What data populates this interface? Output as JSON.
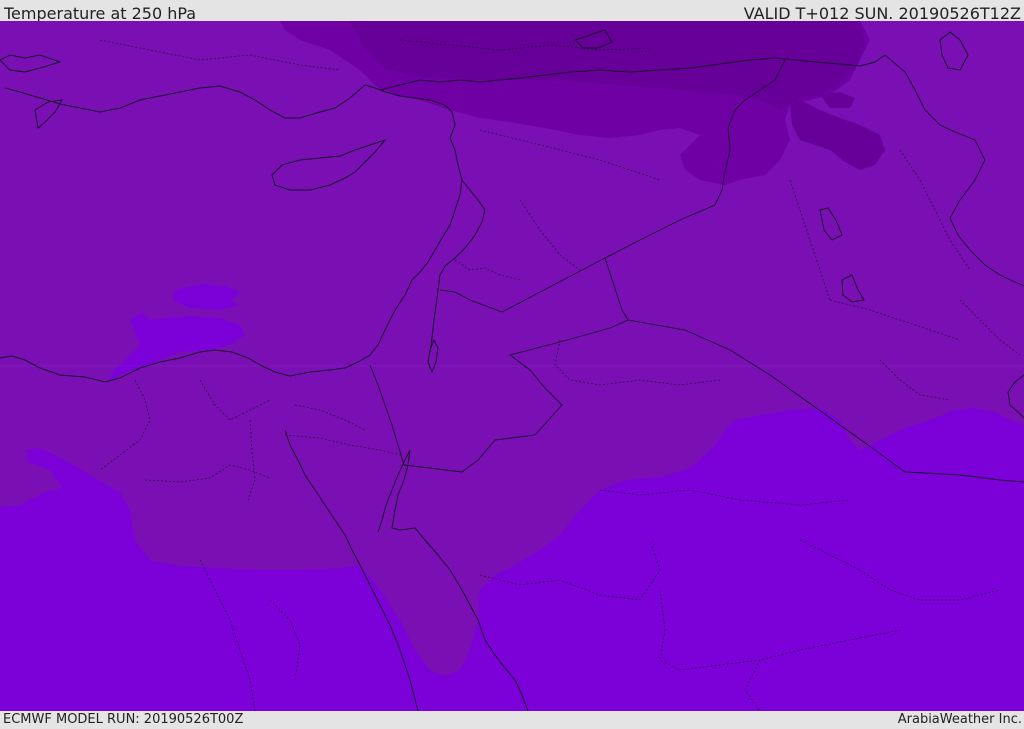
{
  "header": {
    "title": "Temperature at 250 hPa",
    "valid_time": "VALID T+012 SUN. 20190526T12Z"
  },
  "footer": {
    "model_run": "ECMWF MODEL RUN: 20190526T00Z",
    "credit": "ArabiaWeather Inc."
  },
  "colors": {
    "background": "#e4e4e4",
    "band_warm": "#7c00d8",
    "band_mid": "#7a10b4",
    "band_cool": "#6f00a3",
    "band_cold": "#660098",
    "coastline": "#1a1030",
    "border": "#1a1030"
  }
}
